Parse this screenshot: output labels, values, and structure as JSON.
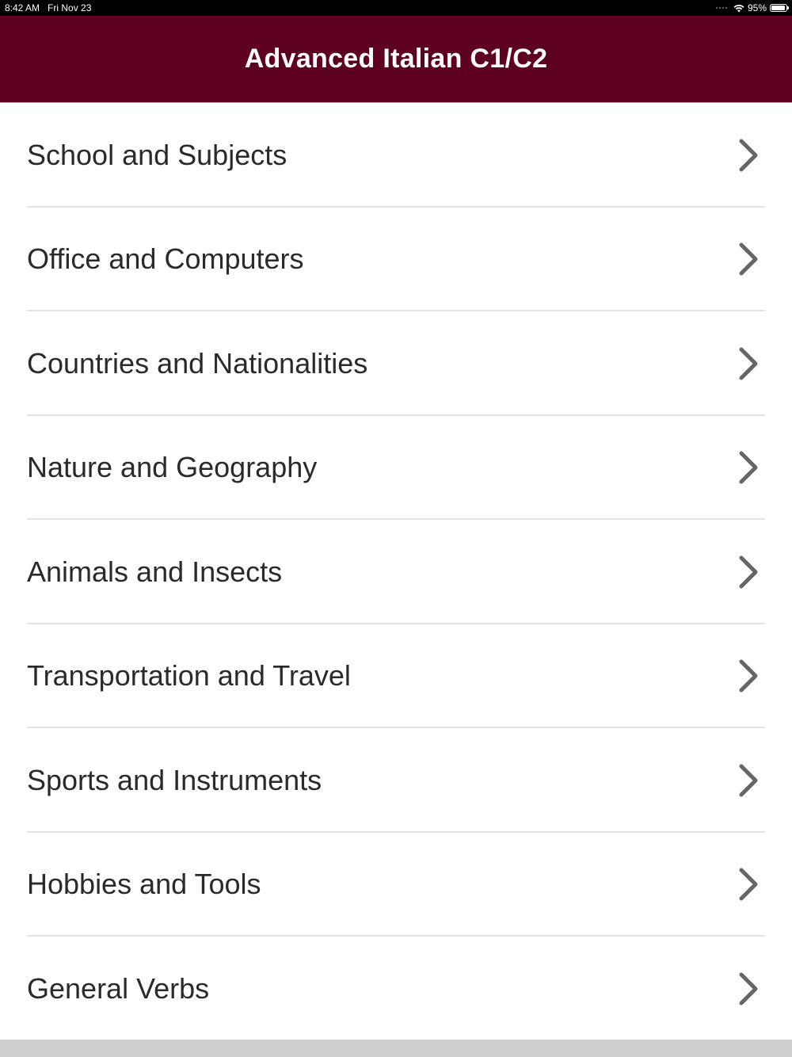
{
  "status_bar": {
    "time": "8:42 AM",
    "date": "Fri Nov 23",
    "battery_percent": "95%",
    "battery_level": 0.95,
    "wifi_icon": "wifi-icon",
    "battery_icon": "battery-icon"
  },
  "nav": {
    "title": "Advanced Italian C1/C2",
    "background_color": "#5e0020"
  },
  "categories": [
    {
      "label": "School and Subjects",
      "icon": "chevron-right-icon"
    },
    {
      "label": "Office and Computers",
      "icon": "chevron-right-icon"
    },
    {
      "label": "Countries and Nationalities",
      "icon": "chevron-right-icon"
    },
    {
      "label": "Nature and Geography",
      "icon": "chevron-right-icon"
    },
    {
      "label": "Animals and Insects",
      "icon": "chevron-right-icon"
    },
    {
      "label": "Transportation and Travel",
      "icon": "chevron-right-icon"
    },
    {
      "label": "Sports and Instruments",
      "icon": "chevron-right-icon"
    },
    {
      "label": "Hobbies and Tools",
      "icon": "chevron-right-icon"
    },
    {
      "label": "General Verbs",
      "icon": "chevron-right-icon"
    }
  ]
}
